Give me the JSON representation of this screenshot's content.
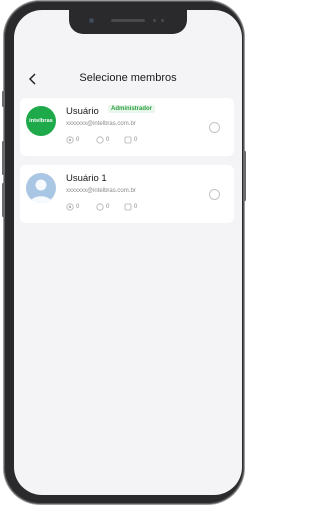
{
  "header": {
    "title": "Selecione membros"
  },
  "members": [
    {
      "name": "Usuário",
      "badge": "Administrador",
      "email": "xxxxxxx@intelbras.com.br",
      "avatar_text": "intelbras",
      "count_a": "0",
      "count_b": "0",
      "count_c": "0"
    },
    {
      "name": "Usuário 1",
      "email": "xxxxxxx@intelbras.com.br",
      "count_a": "0",
      "count_b": "0",
      "count_c": "0"
    }
  ],
  "colors": {
    "accent_green": "#1ea94a",
    "badge_text": "#2ea043"
  }
}
